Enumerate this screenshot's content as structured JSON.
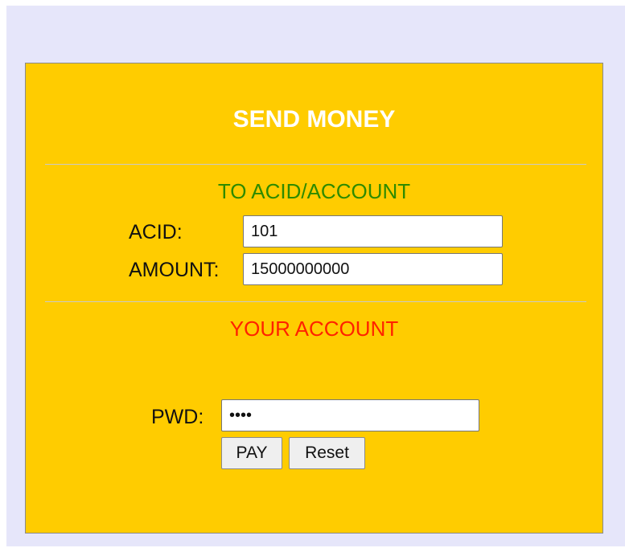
{
  "form": {
    "title": "SEND MONEY",
    "to_section": {
      "heading": "TO ACID/ACCOUNT",
      "acid_label": "ACID:",
      "acid_value": "101",
      "amount_label": "AMOUNT:",
      "amount_value": "15000000000"
    },
    "your_section": {
      "heading": "YOUR ACCOUNT",
      "pwd_label": "PWD:",
      "pwd_value": "••••"
    },
    "buttons": {
      "pay_label": "PAY",
      "reset_label": "Reset"
    }
  },
  "colors": {
    "page_background": "#e6e6fa",
    "panel_background": "#ffcc00",
    "title_text": "#ffffff",
    "to_heading_text": "#2e8b00",
    "your_heading_text": "#ff2200"
  }
}
